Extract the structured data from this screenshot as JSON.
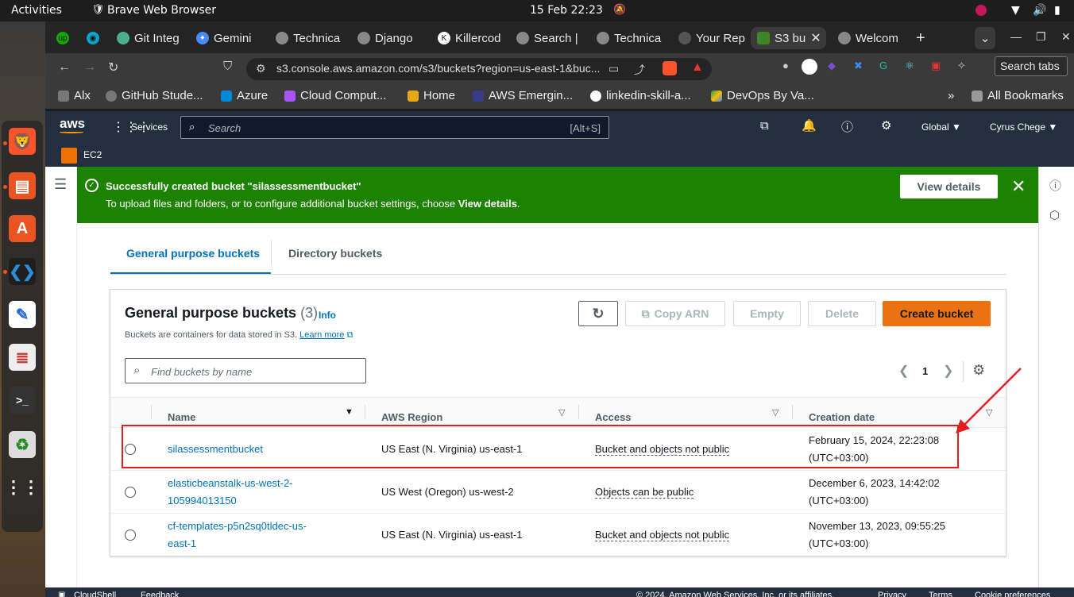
{
  "os": {
    "activities": "Activities",
    "app_name": "Brave Web Browser",
    "clock": "15 Feb  22:23"
  },
  "browser": {
    "tabs": [
      {
        "label": "",
        "icon": "upwork-icon"
      },
      {
        "label": "",
        "icon": "eye-icon"
      },
      {
        "label": "Git Integ",
        "icon": "git-icon"
      },
      {
        "label": "Gemini",
        "icon": "gemini-icon"
      },
      {
        "label": "Technica",
        "icon": "globe-icon"
      },
      {
        "label": "Django",
        "icon": "globe-icon"
      },
      {
        "label": "Killercod",
        "icon": "k-icon"
      },
      {
        "label": "Search |",
        "icon": "globe-icon"
      },
      {
        "label": "Technica",
        "icon": "globe-icon"
      },
      {
        "label": "Your Rep",
        "icon": "github-icon"
      },
      {
        "label": "S3 bu",
        "icon": "s3-icon",
        "active": true
      },
      {
        "label": "Welcom",
        "icon": "globe-icon"
      }
    ],
    "url": "s3.console.aws.amazon.com/s3/buckets?region=us-east-1&buc...",
    "search_tabs_tooltip": "Search tabs",
    "bookmarks": [
      "Alx",
      "GitHub Stude...",
      "Azure",
      "Cloud Comput...",
      "Home",
      "AWS Emergin...",
      "linkedin-skill-a...",
      "DevOps By Va..."
    ],
    "all_bookmarks": "All Bookmarks"
  },
  "aws": {
    "logo": "aws",
    "services": "Services",
    "search_placeholder": "Search",
    "search_shortcut": "[Alt+S]",
    "region": "Global",
    "user": "Cyrus Chege",
    "pinned_service": "EC2"
  },
  "flash": {
    "title": "Successfully created bucket \"silassessmentbucket\"",
    "message_prefix": "To upload files and folders, or to configure additional bucket settings, choose ",
    "message_bold": "View details",
    "message_suffix": ".",
    "view_details": "View details"
  },
  "tabs": {
    "general": "General purpose buckets",
    "directory": "Directory buckets"
  },
  "panel": {
    "title": "General purpose buckets",
    "count": "(3)",
    "info": "Info",
    "description": "Buckets are containers for data stored in S3.",
    "learn_more": "Learn more",
    "copy_arn": "Copy ARN",
    "empty": "Empty",
    "delete": "Delete",
    "create_bucket": "Create bucket",
    "find_placeholder": "Find buckets by name",
    "page": "1"
  },
  "table": {
    "columns": [
      "Name",
      "AWS Region",
      "Access",
      "Creation date"
    ],
    "rows": [
      {
        "name": "silassessmentbucket",
        "region": "US East (N. Virginia) us-east-1",
        "access": "Bucket and objects not public",
        "date": "February 15, 2024, 22:23:08",
        "tz": "(UTC+03:00)"
      },
      {
        "name1": "elasticbeanstalk-us-west-2-",
        "name2": "105994013150",
        "region": "US West (Oregon) us-west-2",
        "access": "Objects can be public",
        "date": "December 6, 2023, 14:42:02",
        "tz": "(UTC+03:00)"
      },
      {
        "name1": "cf-templates-p5n2sq0tldec-us-",
        "name2": "east-1",
        "region": "US East (N. Virginia) us-east-1",
        "access": "Bucket and objects not public",
        "date": "November 13, 2023, 09:55:25",
        "tz": "(UTC+03:00)"
      }
    ]
  },
  "footer": {
    "cloudshell": "CloudShell",
    "feedback": "Feedback",
    "copyright": "© 2024, Amazon Web Services, Inc. or its affiliates.",
    "privacy": "Privacy",
    "terms": "Terms",
    "cookie": "Cookie preferences"
  },
  "colors": {
    "flash_green": "#1d8102",
    "primary_orange": "#ec7211",
    "aws_nav": "#232f3e",
    "highlight_red": "#e02020",
    "link_blue": "#0073bb"
  }
}
